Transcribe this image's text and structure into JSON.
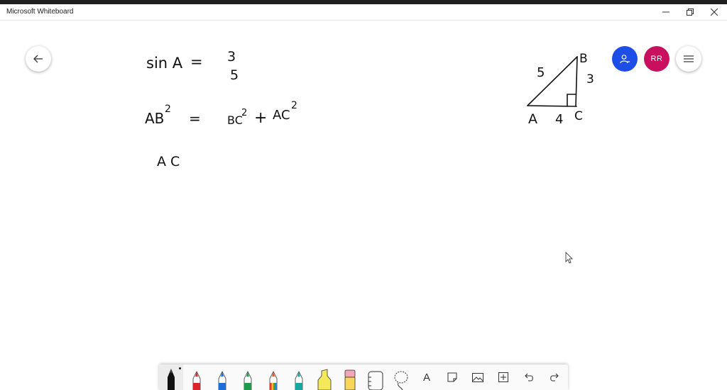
{
  "window": {
    "title": "Microsoft Whiteboard",
    "controls": [
      "minimize",
      "restore",
      "close"
    ]
  },
  "header": {
    "back_icon": "arrow-left-icon",
    "share_icon": "person-share-icon",
    "avatar_initials": "RR",
    "menu_icon": "hamburger-icon",
    "colors": {
      "share": "#1e4ee8",
      "avatar": "#c8105f"
    }
  },
  "ink": {
    "line1": {
      "lhs": "sin A",
      "eq": "=",
      "numerator": "3",
      "denominator": "5"
    },
    "line2": {
      "lhs": "AB",
      "lhs_exp": "2",
      "eq": "=",
      "t1": "BC",
      "t1_exp": "2",
      "plus": "+",
      "t2": "AC",
      "t2_exp": "2"
    },
    "line3": {
      "text": "A C"
    },
    "triangle": {
      "vertex_a": "A",
      "vertex_b": "B",
      "vertex_c": "C",
      "side_ab": "5",
      "side_bc": "3",
      "side_ac": "4"
    }
  },
  "toolbar": {
    "tools": [
      {
        "name": "black-pen",
        "icon": "pen-icon",
        "color": "#111111",
        "selected": true
      },
      {
        "name": "red-pen",
        "icon": "pen-icon",
        "color": "#d9262c"
      },
      {
        "name": "blue-pen",
        "icon": "pen-icon",
        "color": "#1c6fd8"
      },
      {
        "name": "green-pen",
        "icon": "pen-icon",
        "color": "#1e9b4a"
      },
      {
        "name": "rainbow-pen",
        "icon": "pen-icon",
        "color": "#e35b2b"
      },
      {
        "name": "galaxy-pen",
        "icon": "pen-icon",
        "color": "#1aa6a0"
      },
      {
        "name": "highlighter",
        "icon": "highlighter-icon",
        "color": "#f5e85b"
      },
      {
        "name": "eraser",
        "icon": "eraser-icon",
        "color": "#f2a7b8"
      },
      {
        "name": "ruler",
        "icon": "ruler-icon"
      },
      {
        "name": "lasso",
        "icon": "lasso-icon"
      },
      {
        "name": "text",
        "icon": "text-icon",
        "label": "A"
      },
      {
        "name": "sticky-note",
        "icon": "note-icon"
      },
      {
        "name": "image",
        "icon": "image-icon"
      },
      {
        "name": "add",
        "icon": "plus-box-icon"
      },
      {
        "name": "undo",
        "icon": "undo-icon"
      },
      {
        "name": "redo",
        "icon": "redo-icon"
      }
    ]
  }
}
